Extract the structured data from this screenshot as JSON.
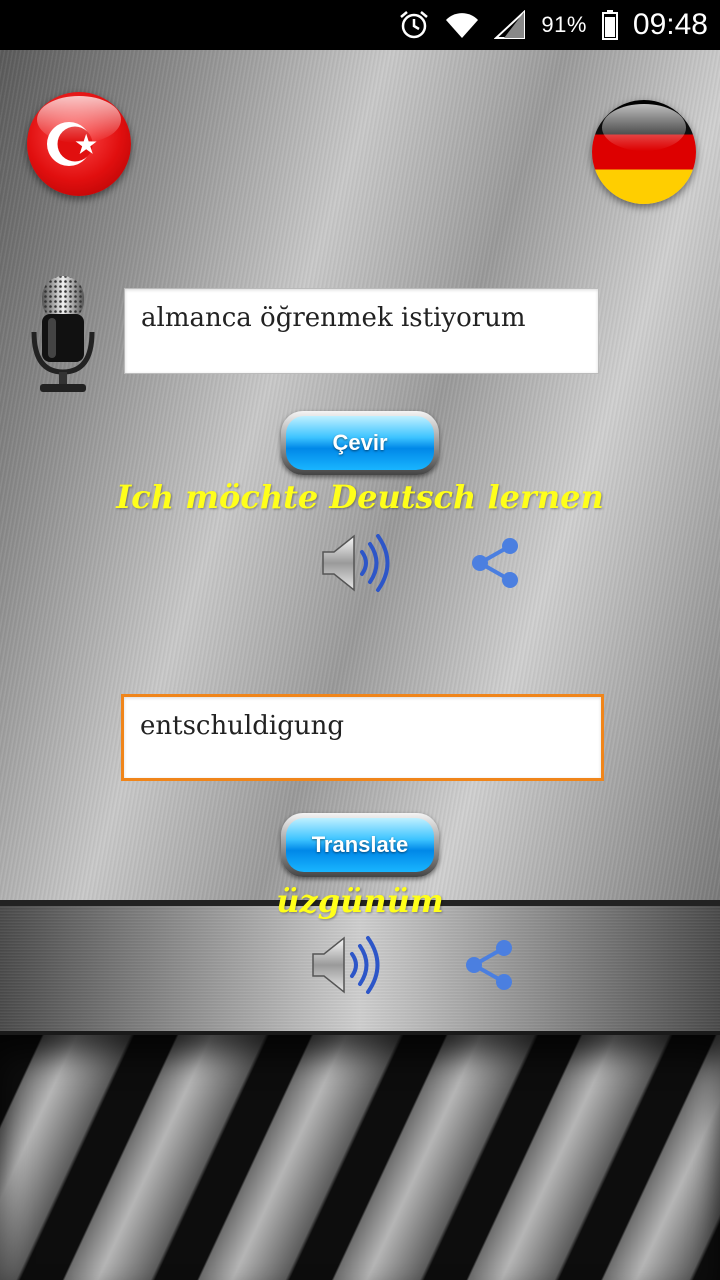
{
  "status_bar": {
    "battery_percent": "91%",
    "time": "09:48",
    "icons": [
      "alarm-icon",
      "wifi-icon",
      "signal-icon",
      "battery-icon"
    ]
  },
  "flags": {
    "source": "turkey-flag-icon",
    "target": "germany-flag-icon"
  },
  "top_section": {
    "input_value": "almanca öğrenmek istiyorum",
    "button_label": "Çevir",
    "result_text": "Ich möchte Deutsch lernen"
  },
  "bottom_section": {
    "input_value": "entschuldigung",
    "button_label": "Translate",
    "result_text": "üzgünüm"
  },
  "colors": {
    "result_text": "#ffff1a",
    "focused_border": "#f0851a",
    "button_blue": "#19b5ff",
    "share_blue": "#4b7fe0"
  }
}
